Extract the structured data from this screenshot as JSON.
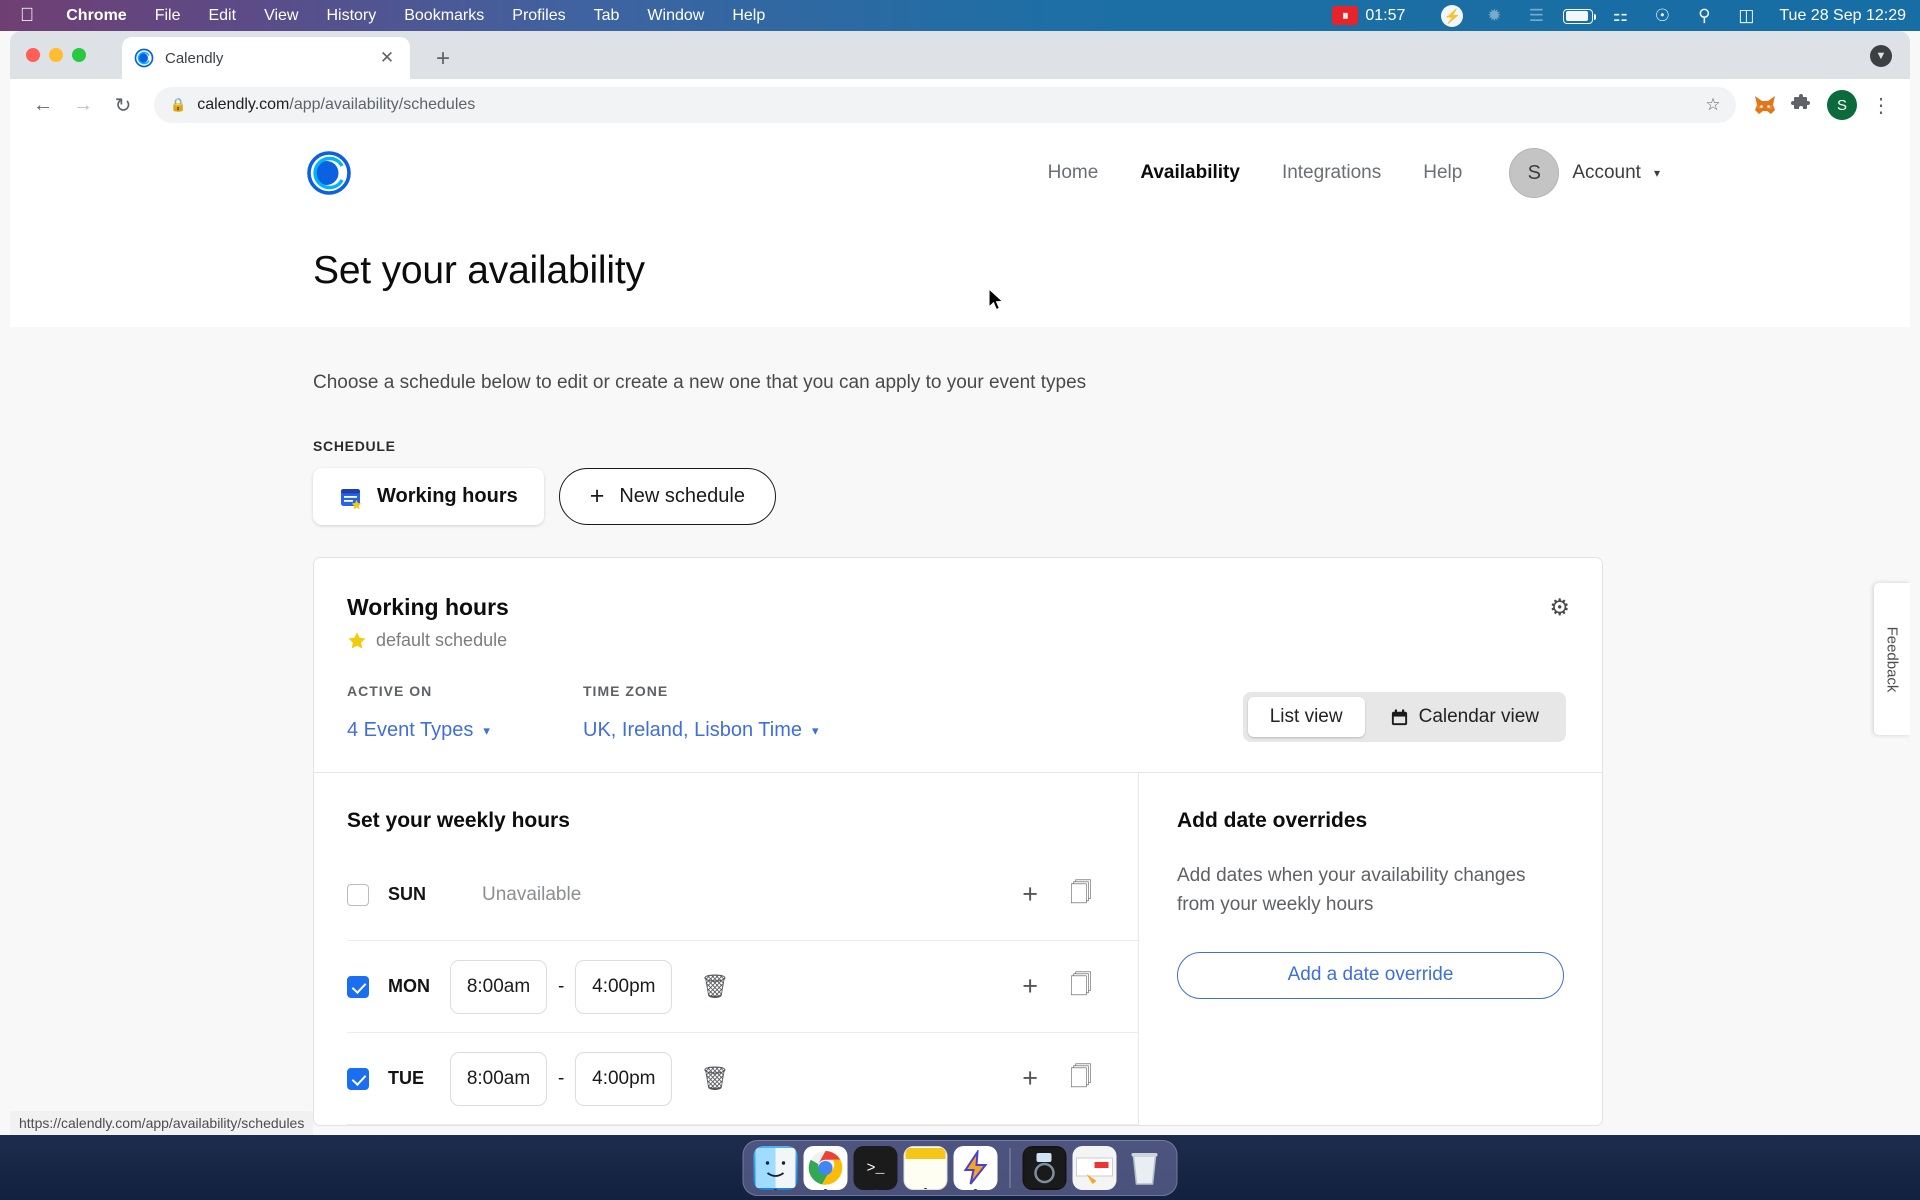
{
  "menubar": {
    "apple_icon": "apple-icon",
    "items": [
      {
        "label": "Chrome",
        "bold": true
      },
      {
        "label": "File",
        "bold": false
      },
      {
        "label": "Edit",
        "bold": false
      },
      {
        "label": "View",
        "bold": false
      },
      {
        "label": "History",
        "bold": false
      },
      {
        "label": "Bookmarks",
        "bold": false
      },
      {
        "label": "Profiles",
        "bold": false
      },
      {
        "label": "Tab",
        "bold": false
      },
      {
        "label": "Window",
        "bold": false
      },
      {
        "label": "Help",
        "bold": false
      }
    ],
    "recording_badge": "recording-indicator",
    "recording_time": "01:57",
    "status_icons": [
      "bolt-icon",
      "bluetooth-icon",
      "wifi-icon",
      "battery-icon",
      "wifi-icon",
      "user-icon",
      "search-icon",
      "control-center-icon"
    ],
    "clock": "Tue 28 Sep  12:29"
  },
  "browser": {
    "tab": {
      "title": "Calendly",
      "favicon": "calendly-favicon",
      "close": "✕"
    },
    "new_tab": "+",
    "tab_overflow": "▼",
    "nav": {
      "back": "←",
      "forward": "→",
      "reload": "↻"
    },
    "omnibox": {
      "lock": "🔒",
      "url_domain": "calendly.com",
      "url_path": "/app/availability/schedules",
      "star": "☆"
    },
    "toolbar_icons": [
      "metamask-fox-icon",
      "extensions-puzzle-icon"
    ],
    "profile_avatar": "S",
    "menu": "⋮",
    "status_bar_url": "https://calendly.com/app/availability/schedules"
  },
  "site": {
    "logo": "calendly-logo",
    "nav": [
      {
        "label": "Home",
        "active": false
      },
      {
        "label": "Availability",
        "active": true
      },
      {
        "label": "Integrations",
        "active": false
      },
      {
        "label": "Help",
        "active": false
      }
    ],
    "account": {
      "avatar_initial": "S",
      "label": "Account",
      "caret": "▾"
    }
  },
  "main": {
    "page_title": "Set your availability",
    "subtitle": "Choose a schedule below to edit or create a new one that you can apply to your event types",
    "schedule_label": "SCHEDULE",
    "schedule_button": {
      "label": "Working hours",
      "icon": "calendar-star-icon"
    },
    "new_schedule_button": {
      "label": "New schedule",
      "icon": "plus-icon"
    }
  },
  "card": {
    "title": "Working hours",
    "default_badge": {
      "icon": "star-icon",
      "text": "default schedule"
    },
    "settings_icon": "gear-icon",
    "active_on": {
      "heading": "ACTIVE ON",
      "value": "4 Event Types",
      "caret": "⌄"
    },
    "time_zone": {
      "heading": "TIME ZONE",
      "value": "UK, Ireland, Lisbon Time",
      "caret": "⌄"
    },
    "view_toggle": {
      "list": {
        "label": "List view",
        "active": true
      },
      "calendar": {
        "label": "Calendar view",
        "active": false,
        "icon": "calendar-icon"
      }
    },
    "weekly": {
      "heading": "Set your weekly hours",
      "days": [
        {
          "day": "SUN",
          "enabled": false,
          "unavailable_text": "Unavailable",
          "start": null,
          "end": null
        },
        {
          "day": "MON",
          "enabled": true,
          "unavailable_text": null,
          "start": "8:00am",
          "end": "4:00pm"
        },
        {
          "day": "TUE",
          "enabled": true,
          "unavailable_text": null,
          "start": "8:00am",
          "end": "4:00pm"
        }
      ],
      "dash": "-",
      "add_icon": "plus-icon",
      "copy_icon": "duplicate-icon",
      "delete_icon": "trash-icon"
    },
    "overrides": {
      "heading": "Add date overrides",
      "description": "Add dates when your availability changes from your weekly hours",
      "button_label": "Add a date override"
    }
  },
  "feedback_tab": "Feedback",
  "dock": {
    "items": [
      {
        "name": "finder",
        "glyph": "🙂"
      },
      {
        "name": "chrome",
        "glyph": ""
      },
      {
        "name": "terminal",
        "glyph": ">_"
      },
      {
        "name": "stickies",
        "glyph": ""
      },
      {
        "name": "lightning-app",
        "glyph": "⚡"
      },
      {
        "name": "camera-app",
        "glyph": ""
      },
      {
        "name": "screenshot-thumbnail",
        "glyph": ""
      },
      {
        "name": "trash",
        "glyph": ""
      }
    ]
  },
  "colors": {
    "accent_blue": "#3f6fdb",
    "checkbox_blue": "#1a6ff0",
    "calendly_blue": "#0b61e0",
    "star_yellow": "#f2cc0c"
  }
}
